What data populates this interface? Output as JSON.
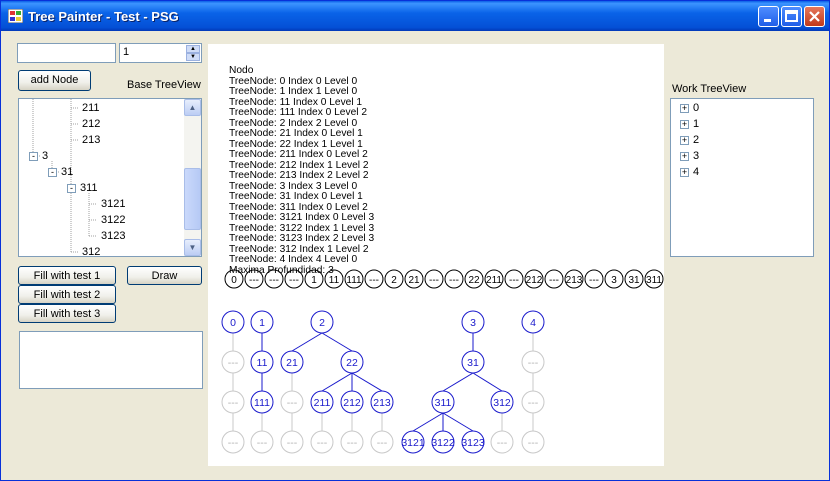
{
  "window": {
    "title": "Tree Painter - Test - PSG"
  },
  "controls": {
    "text_input_value": "",
    "spinner_value": "1",
    "add_node_label": "add Node",
    "base_label": "Base TreeView",
    "work_label": "Work TreeView",
    "fill1_label": "Fill with test 1",
    "fill2_label": "Fill with test 2",
    "fill3_label": "Fill with test 3",
    "draw_label": "Draw"
  },
  "base_tree": [
    {
      "label": "211",
      "indent": 3,
      "toggle": ""
    },
    {
      "label": "212",
      "indent": 3,
      "toggle": ""
    },
    {
      "label": "213",
      "indent": 3,
      "toggle": ""
    },
    {
      "label": "3",
      "indent": 0,
      "toggle": "-"
    },
    {
      "label": "31",
      "indent": 1,
      "toggle": "-"
    },
    {
      "label": "311",
      "indent": 2,
      "toggle": "-"
    },
    {
      "label": "3121",
      "indent": 4,
      "toggle": ""
    },
    {
      "label": "3122",
      "indent": 4,
      "toggle": ""
    },
    {
      "label": "3123",
      "indent": 4,
      "toggle": ""
    },
    {
      "label": "312",
      "indent": 3,
      "toggle": ""
    }
  ],
  "work_tree": [
    {
      "label": "0",
      "toggle": "+"
    },
    {
      "label": "1",
      "toggle": "+"
    },
    {
      "label": "2",
      "toggle": "+"
    },
    {
      "label": "3",
      "toggle": "+"
    },
    {
      "label": "4",
      "toggle": "+"
    }
  ],
  "info_lines": [
    "Nodo",
    "TreeNode: 0 Index 0 Level 0",
    "TreeNode: 1 Index 1 Level 0",
    "TreeNode: 11 Index 0 Level 1",
    "TreeNode: 111 Index 0 Level 2",
    "TreeNode: 2 Index 2 Level 0",
    "TreeNode: 21 Index 0 Level 1",
    "TreeNode: 22 Index 1 Level 1",
    "TreeNode: 211 Index 0 Level 2",
    "TreeNode: 212 Index 1 Level 2",
    "TreeNode: 213 Index 2 Level 2",
    "TreeNode: 3 Index 3 Level 0",
    "TreeNode: 31 Index 0 Level 1",
    "TreeNode: 311 Index 0 Level 2",
    "TreeNode: 3121 Index 0 Level 3",
    "TreeNode: 3122 Index 1 Level 3",
    "TreeNode: 3123 Index 2 Level 3",
    "TreeNode: 312 Index 1 Level 2",
    "TreeNode: 4 Index 4 Level 0",
    "Maxima Profundidad: 3"
  ],
  "sequence": [
    "0",
    "---",
    "---",
    "---",
    "1",
    "11",
    "111",
    "---",
    "2",
    "21",
    "---",
    "---",
    "22",
    "211",
    "---",
    "212",
    "---",
    "213",
    "---",
    "3",
    "31",
    "311"
  ],
  "tree_nodes": [
    {
      "label": "0",
      "col": 0,
      "row": 0,
      "empty": false
    },
    {
      "label": "---",
      "col": 0,
      "row": 1,
      "empty": true
    },
    {
      "label": "---",
      "col": 0,
      "row": 2,
      "empty": true
    },
    {
      "label": "---",
      "col": 0,
      "row": 3,
      "empty": true
    },
    {
      "label": "1",
      "col": 1,
      "row": 0,
      "empty": false
    },
    {
      "label": "11",
      "col": 1,
      "row": 1,
      "empty": false
    },
    {
      "label": "111",
      "col": 1,
      "row": 2,
      "empty": false
    },
    {
      "label": "---",
      "col": 1,
      "row": 3,
      "empty": true
    },
    {
      "label": "2",
      "col": 3,
      "row": 0,
      "empty": false
    },
    {
      "label": "21",
      "col": 2,
      "row": 1,
      "empty": false
    },
    {
      "label": "---",
      "col": 2,
      "row": 2,
      "empty": true
    },
    {
      "label": "---",
      "col": 2,
      "row": 3,
      "empty": true
    },
    {
      "label": "22",
      "col": 4,
      "row": 1,
      "empty": false
    },
    {
      "label": "211",
      "col": 3,
      "row": 2,
      "empty": false
    },
    {
      "label": "---",
      "col": 3,
      "row": 3,
      "empty": true
    },
    {
      "label": "212",
      "col": 4,
      "row": 2,
      "empty": false
    },
    {
      "label": "---",
      "col": 4,
      "row": 3,
      "empty": true
    },
    {
      "label": "213",
      "col": 5,
      "row": 2,
      "empty": false
    },
    {
      "label": "---",
      "col": 5,
      "row": 3,
      "empty": true
    },
    {
      "label": "3",
      "col": 8,
      "row": 0,
      "empty": false
    },
    {
      "label": "31",
      "col": 8,
      "row": 1,
      "empty": false
    },
    {
      "label": "311",
      "col": 7,
      "row": 2,
      "empty": false
    },
    {
      "label": "3121",
      "col": 6,
      "row": 3,
      "empty": false
    },
    {
      "label": "3122",
      "col": 7,
      "row": 3,
      "empty": false
    },
    {
      "label": "3123",
      "col": 8,
      "row": 3,
      "empty": false
    },
    {
      "label": "312",
      "col": 9,
      "row": 2,
      "empty": false
    },
    {
      "label": "---",
      "col": 9,
      "row": 3,
      "empty": true
    },
    {
      "label": "4",
      "col": 10,
      "row": 0,
      "empty": false
    },
    {
      "label": "---",
      "col": 10,
      "row": 1,
      "empty": true
    },
    {
      "label": "---",
      "col": 10,
      "row": 2,
      "empty": true
    },
    {
      "label": "---",
      "col": 10,
      "row": 3,
      "empty": true
    }
  ],
  "tree_edges": [
    [
      "0",
      "0-1"
    ],
    [
      "0-1",
      "0-2"
    ],
    [
      "0-2",
      "0-3"
    ],
    [
      "1",
      "11"
    ],
    [
      "11",
      "111"
    ],
    [
      "111",
      "1-3"
    ],
    [
      "2",
      "21"
    ],
    [
      "2",
      "22"
    ],
    [
      "21",
      "21-2"
    ],
    [
      "21-2",
      "21-3"
    ],
    [
      "22",
      "211"
    ],
    [
      "22",
      "212"
    ],
    [
      "22",
      "213"
    ],
    [
      "211",
      "211-3"
    ],
    [
      "212",
      "212-3"
    ],
    [
      "213",
      "213-3"
    ],
    [
      "3",
      "31"
    ],
    [
      "31",
      "311"
    ],
    [
      "31",
      "312"
    ],
    [
      "311",
      "3121"
    ],
    [
      "311",
      "3122"
    ],
    [
      "311",
      "3123"
    ],
    [
      "312",
      "312-3"
    ],
    [
      "4",
      "4-1"
    ],
    [
      "4-1",
      "4-2"
    ],
    [
      "4-2",
      "4-3"
    ]
  ],
  "colors": {
    "node": "#1a1acc",
    "empty": "#c8c8c8",
    "titlebar": "#0a5fe6"
  }
}
